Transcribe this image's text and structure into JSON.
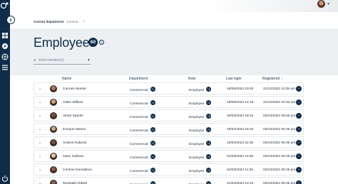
{
  "header": {
    "dept_label": "Current department:",
    "dept_value": "Comme..."
  },
  "page": {
    "title": "Employees",
    "count": "60",
    "search_placeholder": "Find member(s)"
  },
  "columns": [
    "Name",
    "Department",
    "Role",
    "Last login",
    "Registered"
  ],
  "rows": [
    {
      "name": "Carmen Muster",
      "department": "Commercial",
      "dept_badge": "+1",
      "role": "Employee",
      "role_badge": "+1",
      "last_login": "15/05/2023 23:40",
      "registered": "21/12/2022 11:05 am",
      "avatar": "#b07a62"
    },
    {
      "name": "Hailie Wilkins",
      "department": "Commercial",
      "dept_badge": "+1",
      "role": "Employee",
      "role_badge": "+1",
      "last_login": "18/05/2023 14:15",
      "registered": "21/12/2022 10:40 am",
      "avatar": "#d1a07f"
    },
    {
      "name": "Aleah Sparks",
      "department": "Commercial",
      "dept_badge": "+1",
      "role": "Employee",
      "role_badge": "+1",
      "last_login": "20/03/2023 18:22",
      "registered": "03/10/2022 06:55 pm",
      "avatar": "#7a5040"
    },
    {
      "name": "Enrique Mason",
      "department": "Commercial",
      "dept_badge": "+1",
      "role": "Employee",
      "role_badge": "+1",
      "last_login": "28/02/2023 15:32",
      "registered": "03/10/2022 06:36 pm",
      "avatar": "#c8a882"
    },
    {
      "name": "Andres Roberts",
      "department": "Commercial",
      "dept_badge": "+1",
      "role": "Employee",
      "role_badge": "+1",
      "last_login": "10/02/2023 22:30",
      "registered": "03/10/2022 06:35 pm",
      "avatar": "#6a5040"
    },
    {
      "name": "Issac Sullivan",
      "department": "Commercial",
      "dept_badge": "+1",
      "role": "Employee",
      "role_badge": "+1",
      "last_login": "01/03/2023 15:50",
      "registered": "03/10/2022 06:35 pm",
      "avatar": "#e0c3a3"
    },
    {
      "name": "Corinne Donaldson",
      "department": "Commercial",
      "dept_badge": "+1",
      "role": "Employee",
      "role_badge": "+1",
      "last_login": "04/03/2023 11:35",
      "registered": "03/10/2022 06:35 pm",
      "avatar": "#8a5a45"
    },
    {
      "name": "Reginald Abbott",
      "department": "Commercial",
      "dept_badge": "+1",
      "role": "Employee",
      "role_badge": "+1",
      "last_login": "21/02/2023 10:10",
      "registered": "03/10/2022 06:35 pm",
      "avatar": "#7a6050"
    }
  ]
}
